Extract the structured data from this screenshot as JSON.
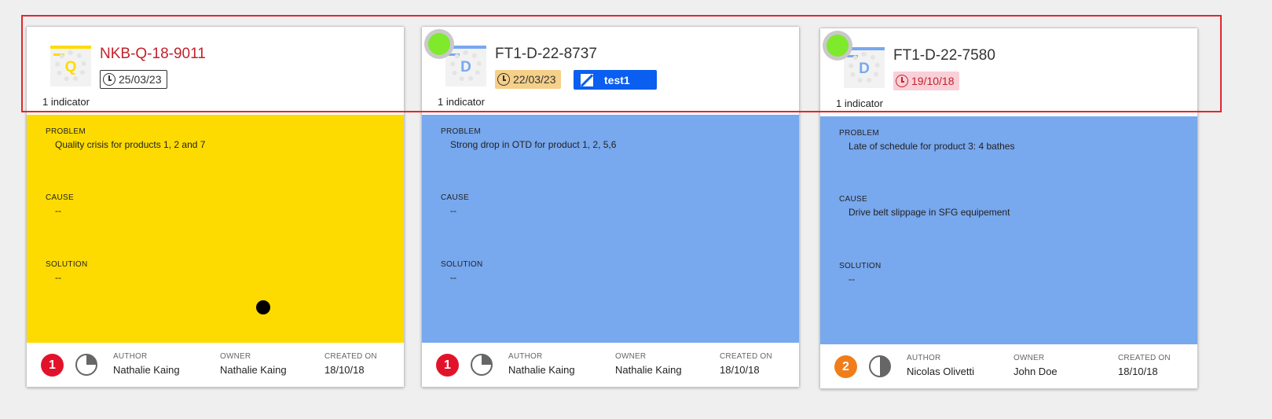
{
  "cards": [
    {
      "title": "NKB-Q-18-9011",
      "thumb_letter": "Q",
      "indicator": "1 indicator",
      "date": "25/03/23",
      "problem_label": "PROBLEM",
      "problem": "Quality crisis for products 1, 2 and 7",
      "cause_label": "CAUSE",
      "cause": "--",
      "solution_label": "SOLUTION",
      "solution": "--",
      "count": "1",
      "author_label": "AUTHOR",
      "author": "Nathalie Kaing",
      "owner_label": "OWNER",
      "owner": "Nathalie Kaing",
      "created_label": "CREATED ON",
      "created": "18/10/18",
      "progress_fraction": 0.25,
      "colors": {
        "body": "#fedb00",
        "title": "#c4212b",
        "thumb_accent": "#fedb00",
        "count": "#e3122b",
        "date_bg": "#ffffff",
        "date_fg": "#333333"
      }
    },
    {
      "title": "FT1-D-22-8737",
      "thumb_letter": "D",
      "indicator": "1 indicator",
      "date": "22/03/23",
      "tag": "test1",
      "problem_label": "PROBLEM",
      "problem": "Strong drop in OTD for product 1, 2, 5,6",
      "cause_label": "CAUSE",
      "cause": "--",
      "solution_label": "SOLUTION",
      "solution": "--",
      "count": "1",
      "author_label": "AUTHOR",
      "author": "Nathalie Kaing",
      "owner_label": "OWNER",
      "owner": "Nathalie Kaing",
      "created_label": "CREATED ON",
      "created": "18/10/18",
      "progress_fraction": 0.25,
      "colors": {
        "body": "#78a8ee",
        "title": "#333333",
        "thumb_accent": "#78a8ee",
        "count": "#e3122b",
        "date_bg": "#f6d089",
        "date_fg": "#333333"
      }
    },
    {
      "title": "FT1-D-22-7580",
      "thumb_letter": "D",
      "indicator": "1 indicator",
      "date": "19/10/18",
      "problem_label": "PROBLEM",
      "problem": "Late of schedule for product 3: 4 bathes",
      "cause_label": "CAUSE",
      "cause": "Drive belt slippage in SFG equipement",
      "solution_label": "SOLUTION",
      "solution": "--",
      "count": "2",
      "author_label": "AUTHOR",
      "author": "Nicolas Olivetti",
      "owner_label": "OWNER",
      "owner": "John Doe",
      "created_label": "CREATED ON",
      "created": "18/10/18",
      "progress_fraction": 0.5,
      "colors": {
        "body": "#78a8ee",
        "title": "#333333",
        "thumb_accent": "#78a8ee",
        "count": "#f07d1a",
        "date_bg": "#f9d0d8",
        "date_fg": "#c4212b"
      }
    }
  ]
}
